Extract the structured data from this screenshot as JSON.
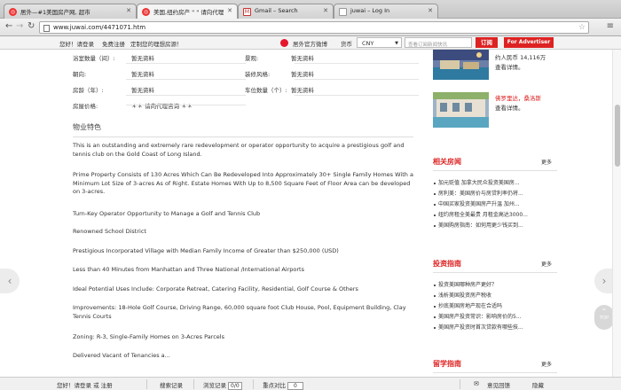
{
  "browser": {
    "tabs": [
      {
        "label": "居外—#1美国房产网, 超市",
        "active": false
      },
      {
        "label": "美国,纽约房产 \" \" 请向代理",
        "active": true
      },
      {
        "label": "Gmail – Search",
        "active": false
      },
      {
        "label": "juwai – Log In",
        "active": false
      }
    ],
    "url": "www.juwai.com/4471071.htm"
  },
  "sitebar": {
    "greeting": "您好！请登录",
    "register": "免费注册",
    "custom": "定制您的理想房源！",
    "weibo": "居外官方微博",
    "currency_label": "货币",
    "currency_value": "CNY",
    "search_placeholder": "查看订阅新闻快讯",
    "subscribe": "订阅",
    "advertiser": "For Advertiser"
  },
  "details": [
    {
      "label": "浴室数量（间）:",
      "value": "暂无资料",
      "label2": "景观:",
      "value2": "暂无资料"
    },
    {
      "label": "朝向:",
      "value": "暂无资料",
      "label2": "装修风格:",
      "value2": "暂无资料"
    },
    {
      "label": "房龄（年）:",
      "value": "暂无资料",
      "label2": "车位数量（个）:",
      "value2": "暂无资料"
    },
    {
      "label": "房屋价格:",
      "value": "＊＊ 请向代理咨询 ＊＊",
      "label2": "",
      "value2": ""
    }
  ],
  "features": {
    "title": "物业特色",
    "paragraphs": [
      "This is an outstanding and extremely rare redevelopment or operator opportunity to acquire a prestigious golf and tennis club on the Gold Coast of Long Island.",
      "Prime Property Consists of 130 Acres Which Can Be Redeveloped Into Approximately 30+ Single Family Homes With a Minimum Lot Size of 3-acres As of Right. Estate Homes With Up to 8,500 Square Feet of Floor Area can be developed on 3-acres.",
      "Turn-Key Operator Opportunity to Manage a Golf and Tennis Club",
      "Renowned School District",
      "Prestigious Incorporated Village with Median Family Income of Greater than $250,000 (USD)",
      "Less than 40 Minutes from Manhattan and Three National /International Airports",
      "Ideal Potential Uses Include: Corporate Retreat, Catering Facility, Residential, Golf Course & Others",
      "Improvements: 18-Hole Golf Course, Driving Range, 60,000 square foot Club House, Pool, Equipment Building, Clay Tennis Courts",
      "Zoning: R-3, Single-Family Homes on 3-Acres Parcels",
      "Delivered Vacant of Tenancies a..."
    ]
  },
  "sidebar": {
    "listing1": {
      "price": "约人民币 14,116万",
      "link": "查看详情。"
    },
    "listing2": {
      "title": "佛罗里达，桑洛斯",
      "link": "查看详情。"
    },
    "sections": [
      {
        "title": "相关房闻",
        "more": "更多",
        "items": [
          "加元贬值 加拿大民众投资美国房...",
          "房利美：美国房价与房贷利率仍将...",
          "中国买家投资美国房产升温 加州...",
          "纽约房租全美最贵 月租金高达3000...",
          "美国购房指南：如何用更少钱买到..."
        ]
      },
      {
        "title": "投资指南",
        "more": "更多",
        "items": [
          "投资美国哪种房产更好？",
          "浅析美国投资房产税收",
          "抄底美国房地产现在合适吗",
          "美国房产投资常识：影响房价的5...",
          "美国房产投资时首次贷款有哪些技..."
        ]
      },
      {
        "title": "留学指南",
        "more": "更多",
        "items": []
      }
    ],
    "top_label": "TOP"
  },
  "bottombar": {
    "greeting": "您好！请登录 或 注册",
    "search_history": "搜索记录",
    "browse_history": "浏览记录",
    "browse_count": "0/0",
    "compare": "重点对比",
    "compare_count": "0",
    "feedback": "意见回馈",
    "hide": "隐藏"
  },
  "colors": {
    "accent": "#dd2222"
  }
}
